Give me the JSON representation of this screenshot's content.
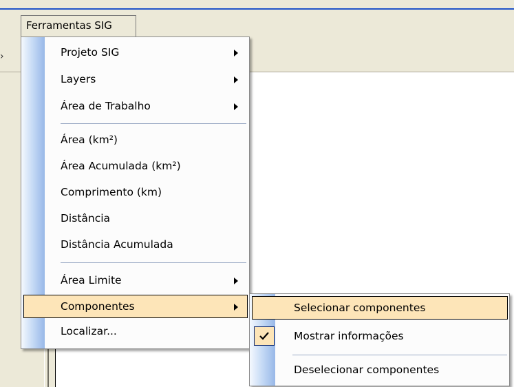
{
  "menubar": {
    "open_menu_label": "Ferramentas SIG"
  },
  "main_menu": {
    "items": [
      {
        "label": "Projeto SIG",
        "submenu": true
      },
      {
        "label": "Layers",
        "submenu": true
      },
      {
        "label": "Área de Trabalho",
        "submenu": true
      },
      {
        "label": "Área (km²)",
        "submenu": false
      },
      {
        "label": "Área Acumulada (km²)",
        "submenu": false
      },
      {
        "label": "Comprimento (km)",
        "submenu": false
      },
      {
        "label": "Distância",
        "submenu": false
      },
      {
        "label": "Distância Acumulada",
        "submenu": false
      },
      {
        "label": "Área Limite",
        "submenu": true
      },
      {
        "label": "Componentes",
        "submenu": true,
        "highlighted": true
      },
      {
        "label": "Localizar...",
        "submenu": false
      }
    ]
  },
  "submenu": {
    "items": [
      {
        "label": "Selecionar componentes",
        "highlighted": true
      },
      {
        "label": "Mostrar informações",
        "checked": true
      },
      {
        "label": "Deselecionar componentes"
      }
    ]
  },
  "colors": {
    "highlight": "#fde5b8",
    "gutter_dark": "#98b8e8",
    "window_bg": "#ece9d8",
    "title_bar_blue": "#1f53c9"
  },
  "icons": {
    "check": "check-icon",
    "arrow": "submenu-arrow-icon"
  }
}
